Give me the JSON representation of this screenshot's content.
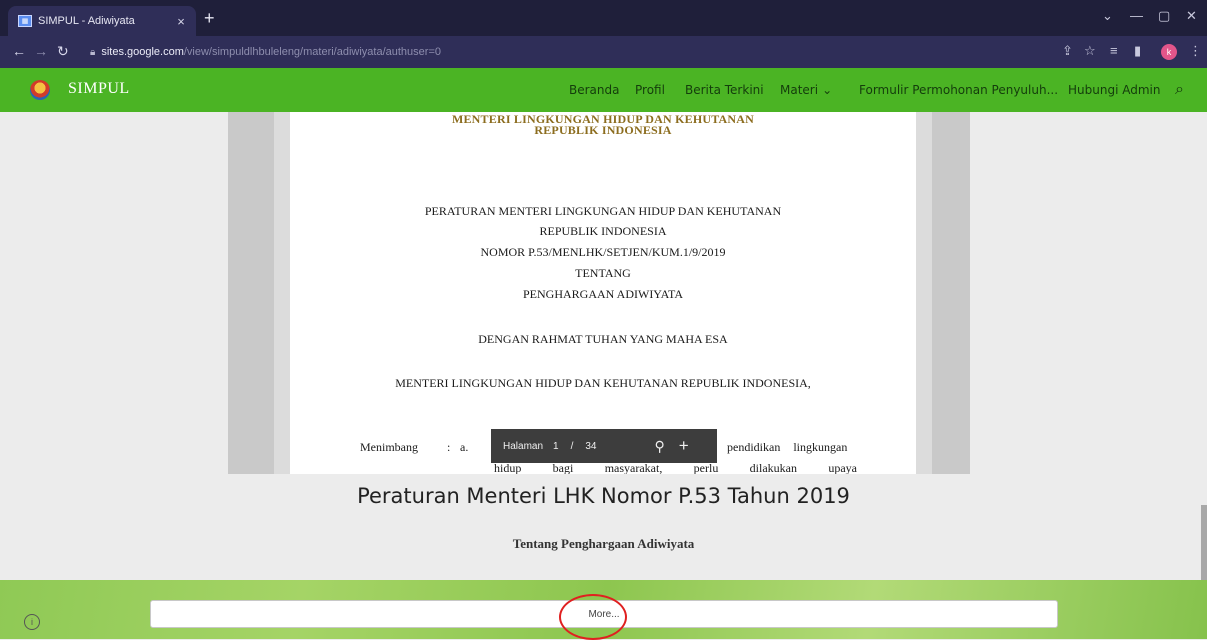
{
  "browser": {
    "tab_title": "SIMPUL - Adiwiyata",
    "url_host": "sites.google.com",
    "url_path": "/view/simpuldlhbuleleng/materi/adiwiyata/authuser=0",
    "profile_initial": "k"
  },
  "site": {
    "name": "SIMPUL",
    "nav": [
      "Beranda",
      "Profil",
      "Berita Terkini",
      "Materi",
      "Formulir Permohonan Penyuluh...",
      "Hubungi Admin"
    ]
  },
  "document": {
    "header_line1": "MENTERI LINGKUNGAN HIDUP DAN KEHUTANAN",
    "header_line2": "REPUBLIK INDONESIA",
    "body_lines": [
      "PERATURAN MENTERI LINGKUNGAN HIDUP DAN KEHUTANAN",
      "REPUBLIK INDONESIA",
      "NOMOR P.53/MENLHK/SETJEN/KUM.1/9/2019",
      "TENTANG",
      "PENGHARGAAN ADIWIYATA"
    ],
    "grace": "DENGAN RAHMAT TUHAN YANG MAHA ESA",
    "minister": "MENTERI LINGKUNGAN HIDUP DAN KEHUTANAN REPUBLIK INDONESIA,",
    "menimbang_label": "Menimbang",
    "menimbang_sep": ":",
    "menimbang_item": "a.",
    "clause_line1_tail": "pendidikan lingkungan",
    "clause_line2": "hidup bagi masyarakat, perlu dilakukan upaya"
  },
  "pdf_toolbar": {
    "page_label": "Halaman",
    "page_current": "1",
    "page_sep": "/",
    "page_total": "34"
  },
  "content": {
    "title": "Peraturan Menteri LHK Nomor P.53 Tahun 2019",
    "subtitle": "Tentang Penghargaan Adiwiyata"
  },
  "footer": {
    "more_label": "More..."
  },
  "colors": {
    "site_header": "#4bb424",
    "browser_frame": "#2f2e58",
    "annotation": "#e02020"
  }
}
